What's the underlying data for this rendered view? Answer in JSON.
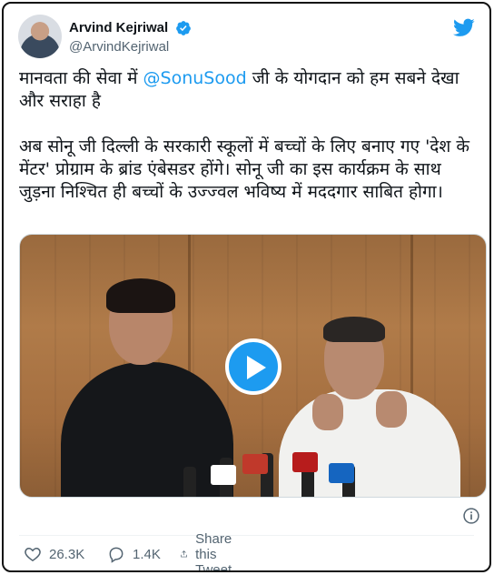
{
  "author": {
    "name": "Arvind Kejriwal",
    "handle": "@ArvindKejriwal"
  },
  "tweet": {
    "line1_before": "मानवता की सेवा में ",
    "mention": "@SonuSood",
    "line1_after": " जी के योगदान को हम सबने देखा और सराहा है",
    "paragraph2": "अब सोनू जी दिल्ली के सरकारी स्कूलों में बच्चों के लिए बनाए गए 'देश के मेंटर' प्रोग्राम के ब्रांड एंबेसडर होंगे। सोनू जी का इस कार्यक्रम के साथ जुड़ना निश्चित ही बच्चों के उज्ज्वल भविष्य में मददगार साबित होगा।"
  },
  "media": {
    "type": "video"
  },
  "stats": {
    "likes": "26.3K",
    "replies": "1.4K",
    "share_label": "Share this Tweet"
  },
  "colors": {
    "accent": "#1d9bf0",
    "text": "#0f1419",
    "muted": "#536471"
  },
  "icons": [
    "verified-badge-icon",
    "twitter-bird-icon",
    "play-icon",
    "info-icon",
    "heart-icon",
    "reply-icon",
    "share-icon"
  ]
}
